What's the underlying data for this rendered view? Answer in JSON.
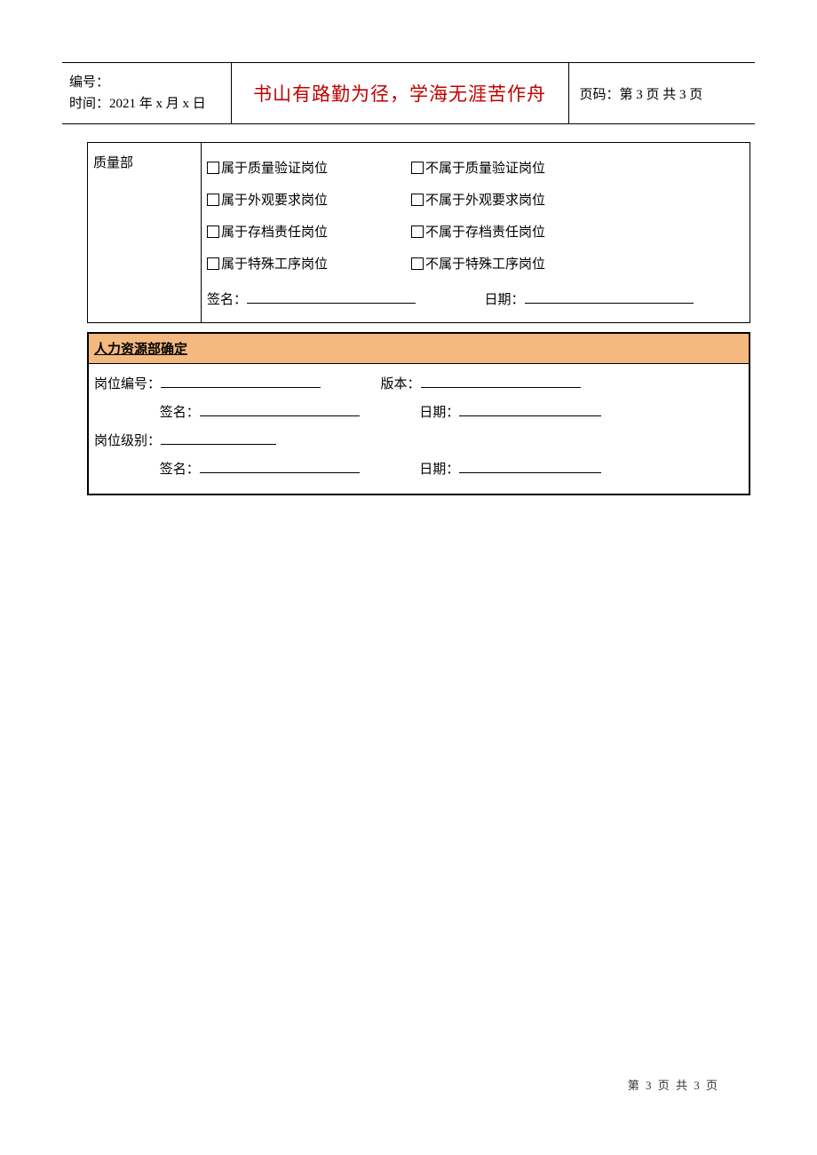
{
  "header": {
    "serial_label": "编号：",
    "time_label": "时间：2021 年 x 月 x 日",
    "motto": "书山有路勤为径，学海无涯苦作舟",
    "page_label": "页码：第 3 页 共 3 页"
  },
  "quality": {
    "dept": "质量部",
    "rows": [
      {
        "yes": "属于质量验证岗位",
        "no": "不属于质量验证岗位"
      },
      {
        "yes": "属于外观要求岗位",
        "no": "不属于外观要求岗位"
      },
      {
        "yes": "属于存档责任岗位",
        "no": "不属于存档责任岗位"
      },
      {
        "yes": "属于特殊工序岗位",
        "no": "不属于特殊工序岗位"
      }
    ],
    "sign_label": "签名：",
    "date_label": "日期："
  },
  "hr": {
    "title": "人力资源部确定",
    "job_no_label": "岗位编号：",
    "version_label": "版本：",
    "sign_label": "签名：",
    "date_label": "日期：",
    "job_level_label": "岗位级别："
  },
  "footer": {
    "text": "第 3 页 共 3 页"
  }
}
